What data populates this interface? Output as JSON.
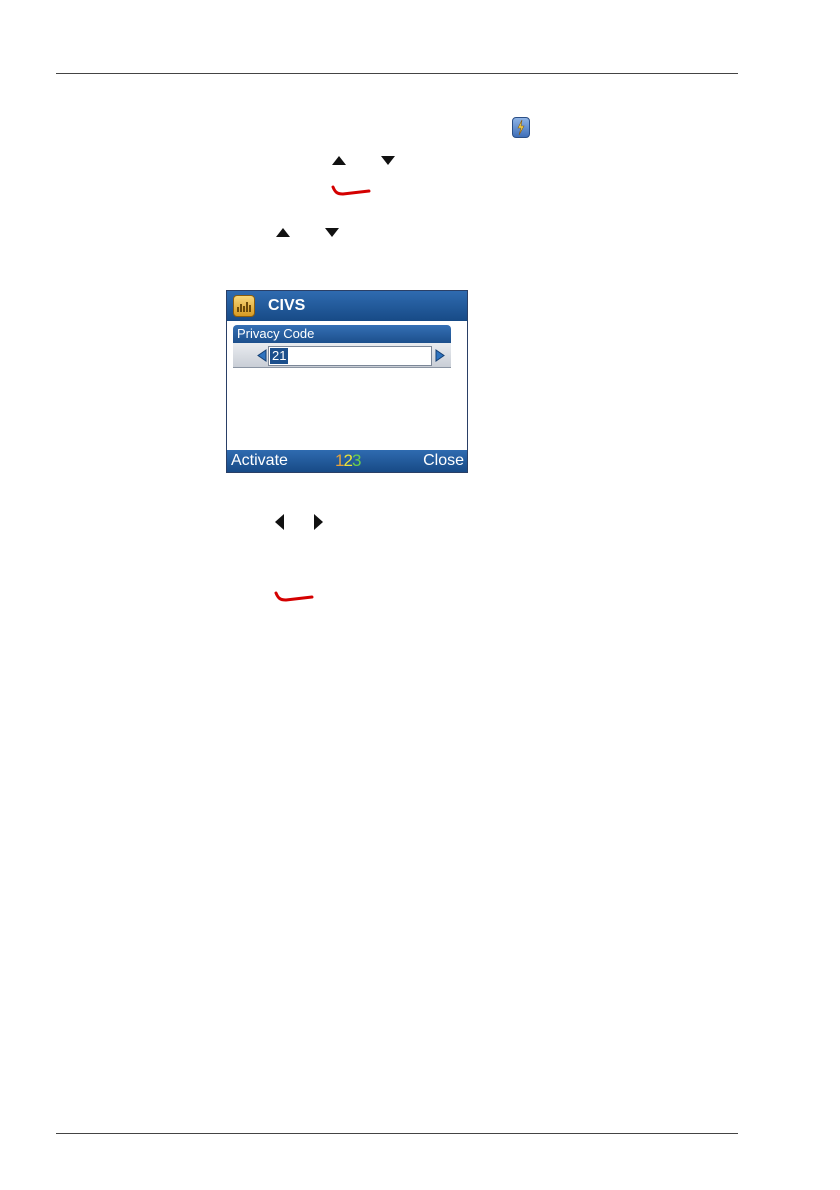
{
  "colors": {
    "end_key_red": "#d40000",
    "title_bar_blue": "#1f5a9c",
    "mode_digit_1": "#e8a33a",
    "mode_digit_2": "#e8e23a",
    "mode_digit_3": "#6cd04a"
  },
  "icons": [
    "flash-icon",
    "up-arrow-icon",
    "down-arrow-icon",
    "end-call-icon",
    "left-arrow-icon",
    "right-arrow-icon",
    "app-icon"
  ],
  "screen": {
    "title": "CIVS",
    "field_label": "Privacy Code",
    "field_value": "21",
    "softkey_left": "Activate",
    "softkey_right": "Close",
    "input_mode": [
      "1",
      "2",
      "3"
    ]
  }
}
